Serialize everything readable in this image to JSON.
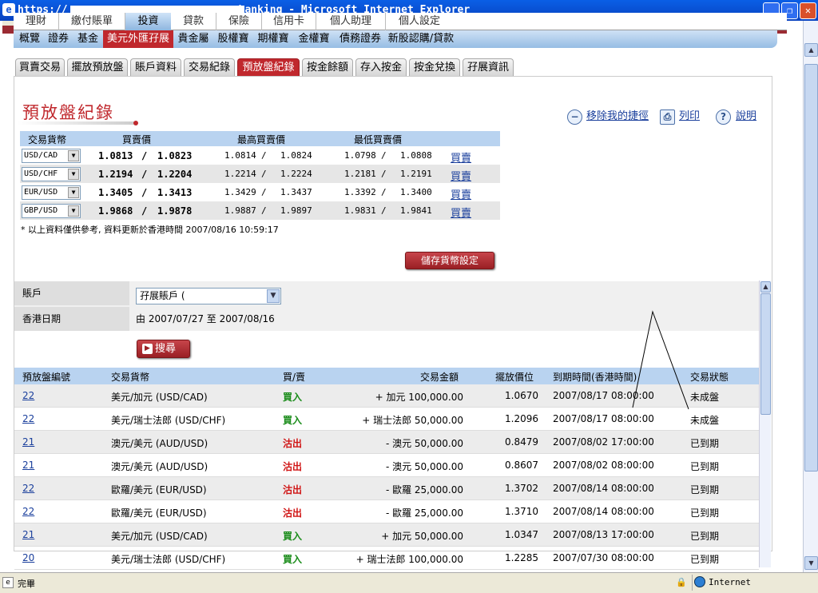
{
  "window": {
    "title_prefix": "https://",
    "title_suffix": "banking - Microsoft Internet Explorer",
    "minimize": "_",
    "maximize": "❐",
    "close": "✕"
  },
  "nav_top": [
    "理財",
    "繳付賬單",
    "投資",
    "貸款",
    "保險",
    "信用卡",
    "個人助理",
    "個人設定"
  ],
  "nav_sub": [
    "概覽",
    "證券",
    "基金",
    "美元外匯孖展",
    "貴金屬",
    "股權寶",
    "期權寶",
    "金權寶",
    "債務證券",
    "新股認購/貸款"
  ],
  "tabs": [
    "買賣交易",
    "擺放預放盤",
    "賬戶資料",
    "交易紀錄",
    "預放盤紀錄",
    "按金餘額",
    "存入按金",
    "按金兌換",
    "孖展資訊"
  ],
  "page_title": "預放盤紀錄",
  "toolbar": {
    "remove_shortcut": "移除我的捷徑",
    "print": "列印",
    "help": "說明"
  },
  "rates": {
    "headers": {
      "pair": "交易貨幣",
      "bid": "買賣價",
      "high": "最高買賣價",
      "low": "最低買賣價"
    },
    "action_label": "買賣",
    "rows": [
      {
        "pair": "USD/CAD",
        "bid1": "1.0813",
        "bid2": "1.0823",
        "hi1": "1.0814",
        "hi2": "1.0824",
        "lo1": "1.0798",
        "lo2": "1.0808"
      },
      {
        "pair": "USD/CHF",
        "bid1": "1.2194",
        "bid2": "1.2204",
        "hi1": "1.2214",
        "hi2": "1.2224",
        "lo1": "1.2181",
        "lo2": "1.2191"
      },
      {
        "pair": "EUR/USD",
        "bid1": "1.3405",
        "bid2": "1.3413",
        "hi1": "1.3429",
        "hi2": "1.3437",
        "lo1": "1.3392",
        "lo2": "1.3400"
      },
      {
        "pair": "GBP/USD",
        "bid1": "1.9868",
        "bid2": "1.9878",
        "hi1": "1.9887",
        "hi2": "1.9897",
        "lo1": "1.9831",
        "lo2": "1.9841"
      }
    ],
    "note": "* 以上資料僅供參考, 資料更新於香港時間 2007/08/16 10:59:17",
    "save_button": "儲存貨幣設定"
  },
  "search": {
    "account_label": "賬戶",
    "account_value": "孖展賬戶 (",
    "date_label": "香港日期",
    "date_range": "由 2007/07/27 至 2007/08/16",
    "search_button": "搜尋"
  },
  "orders": {
    "headers": {
      "ref": "預放盤編號",
      "pair": "交易貨幣",
      "side": "買/賣",
      "amount": "交易金額",
      "price": "擺放價位",
      "expiry": "到期時間(香港時間)",
      "status": "交易狀態"
    },
    "rows": [
      {
        "ref": "22",
        "pair": "美元/加元 (USD/CAD)",
        "side": "買入",
        "side_type": "buy",
        "amount": "+ 加元 100,000.00",
        "price": "1.0670",
        "expiry": "2007/08/17 08:00:00",
        "status": "未成盤"
      },
      {
        "ref": "22",
        "pair": "美元/瑞士法郎 (USD/CHF)",
        "side": "買入",
        "side_type": "buy",
        "amount": "+ 瑞士法郎 50,000.00",
        "price": "1.2096",
        "expiry": "2007/08/17 08:00:00",
        "status": "未成盤"
      },
      {
        "ref": "21",
        "pair": "澳元/美元 (AUD/USD)",
        "side": "沽出",
        "side_type": "sell",
        "amount": "- 澳元 50,000.00",
        "price": "0.8479",
        "expiry": "2007/08/02 17:00:00",
        "status": "已到期"
      },
      {
        "ref": "21",
        "pair": "澳元/美元 (AUD/USD)",
        "side": "沽出",
        "side_type": "sell",
        "amount": "- 澳元 50,000.00",
        "price": "0.8607",
        "expiry": "2007/08/02 08:00:00",
        "status": "已到期"
      },
      {
        "ref": "22",
        "pair": "歐羅/美元 (EUR/USD)",
        "side": "沽出",
        "side_type": "sell",
        "amount": "- 歐羅 25,000.00",
        "price": "1.3702",
        "expiry": "2007/08/14 08:00:00",
        "status": "已到期"
      },
      {
        "ref": "22",
        "pair": "歐羅/美元 (EUR/USD)",
        "side": "沽出",
        "side_type": "sell",
        "amount": "- 歐羅 25,000.00",
        "price": "1.3710",
        "expiry": "2007/08/14 08:00:00",
        "status": "已到期"
      },
      {
        "ref": "21",
        "pair": "美元/加元 (USD/CAD)",
        "side": "買入",
        "side_type": "buy",
        "amount": "+ 加元 50,000.00",
        "price": "1.0347",
        "expiry": "2007/08/13 17:00:00",
        "status": "已到期"
      },
      {
        "ref": "20",
        "pair": "美元/瑞士法郎 (USD/CHF)",
        "side": "買入",
        "side_type": "buy",
        "amount": "+ 瑞士法郎 100,000.00",
        "price": "1.2285",
        "expiry": "2007/07/30 08:00:00",
        "status": "已到期"
      }
    ]
  },
  "status": {
    "left": "完畢",
    "zone": "Internet"
  },
  "icons": {
    "page": "ie-page-icon",
    "lock": "lock-icon",
    "globe": "internet-zone-icon",
    "remove": "remove-circle-icon",
    "print": "printer-icon",
    "help": "help-icon"
  },
  "colors": {
    "brand_red": "#c0282d",
    "header_blue": "#b9d3f0",
    "buy_green": "#1a8c1a",
    "sell_red": "#d01515"
  }
}
